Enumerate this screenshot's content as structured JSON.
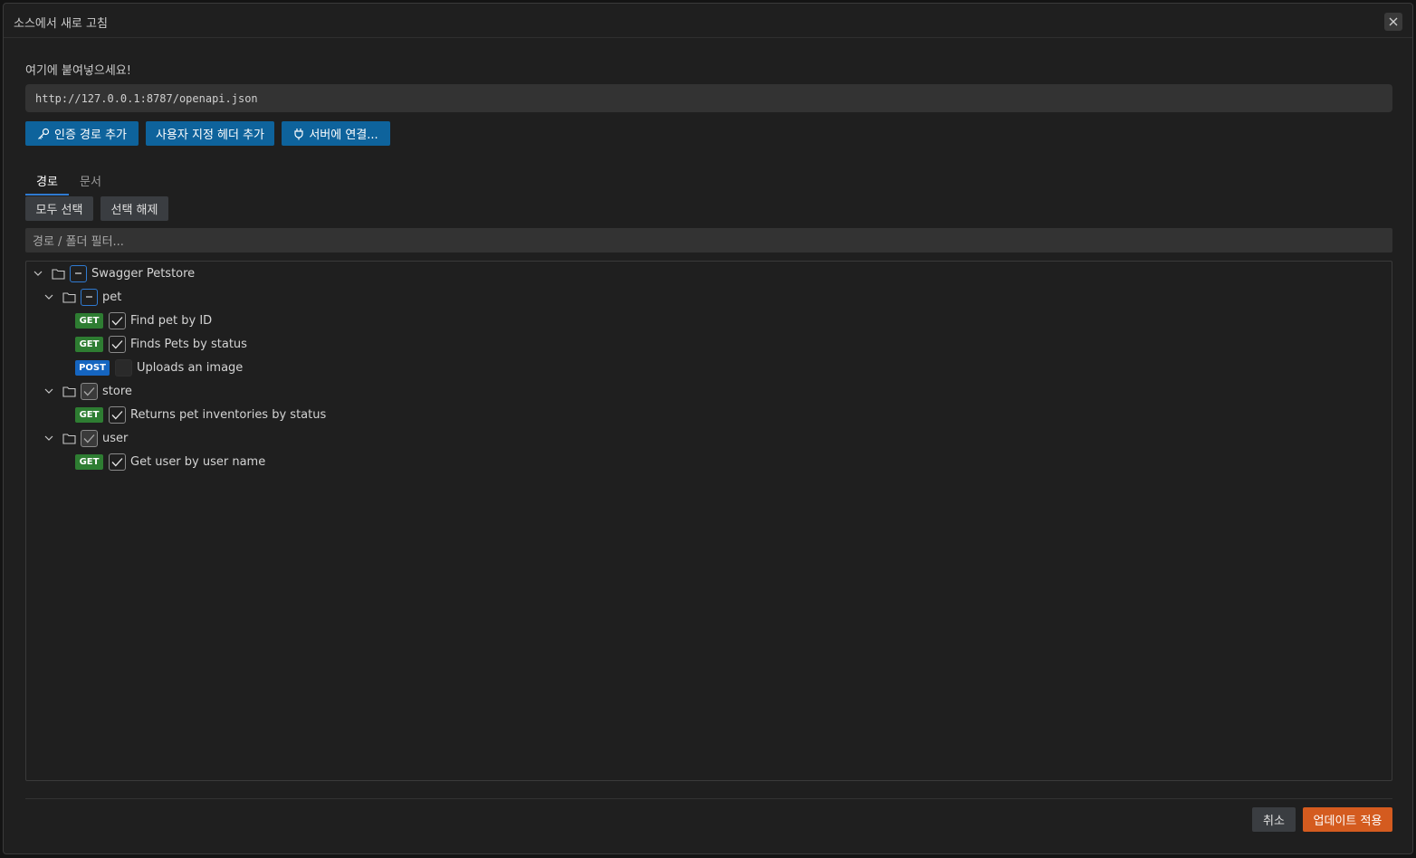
{
  "dialog": {
    "title": "소스에서 새로 고침",
    "close_icon": "close-icon"
  },
  "source": {
    "label": "여기에 붙여넣으세요!",
    "url": "http://127.0.0.1:8787/openapi.json"
  },
  "actions": {
    "add_auth_route": "인증 경로 추가",
    "add_custom_header": "사용자 지정 헤더 추가",
    "connect_server": "서버에 연결..."
  },
  "tabs": {
    "routes": "경로",
    "docs": "문서",
    "active": "경로"
  },
  "selection": {
    "select_all": "모두 선택",
    "deselect": "선택 해제"
  },
  "filter": {
    "placeholder": "경로 / 폴더 필터..."
  },
  "tree": {
    "root": {
      "name": "Swagger Petstore",
      "state": "partial"
    },
    "pet": {
      "name": "pet",
      "state": "partial",
      "items": [
        {
          "method": "GET",
          "label": "Find pet by ID",
          "checked": true
        },
        {
          "method": "GET",
          "label": "Finds Pets by status",
          "checked": true
        },
        {
          "method": "POST",
          "label": "Uploads an image",
          "checked": false
        }
      ]
    },
    "store": {
      "name": "store",
      "state": "checked",
      "items": [
        {
          "method": "GET",
          "label": "Returns pet inventories by status",
          "checked": true
        }
      ]
    },
    "user": {
      "name": "user",
      "state": "checked",
      "items": [
        {
          "method": "GET",
          "label": "Get user by user name",
          "checked": true
        }
      ]
    }
  },
  "footer": {
    "cancel": "취소",
    "apply": "업데이트 적용"
  },
  "colors": {
    "primary_button": "#0e639c",
    "apply_button": "#d45b1f",
    "get_badge": "#2e7d32",
    "post_badge": "#1565c0",
    "tab_underline": "#2f7ad1"
  }
}
